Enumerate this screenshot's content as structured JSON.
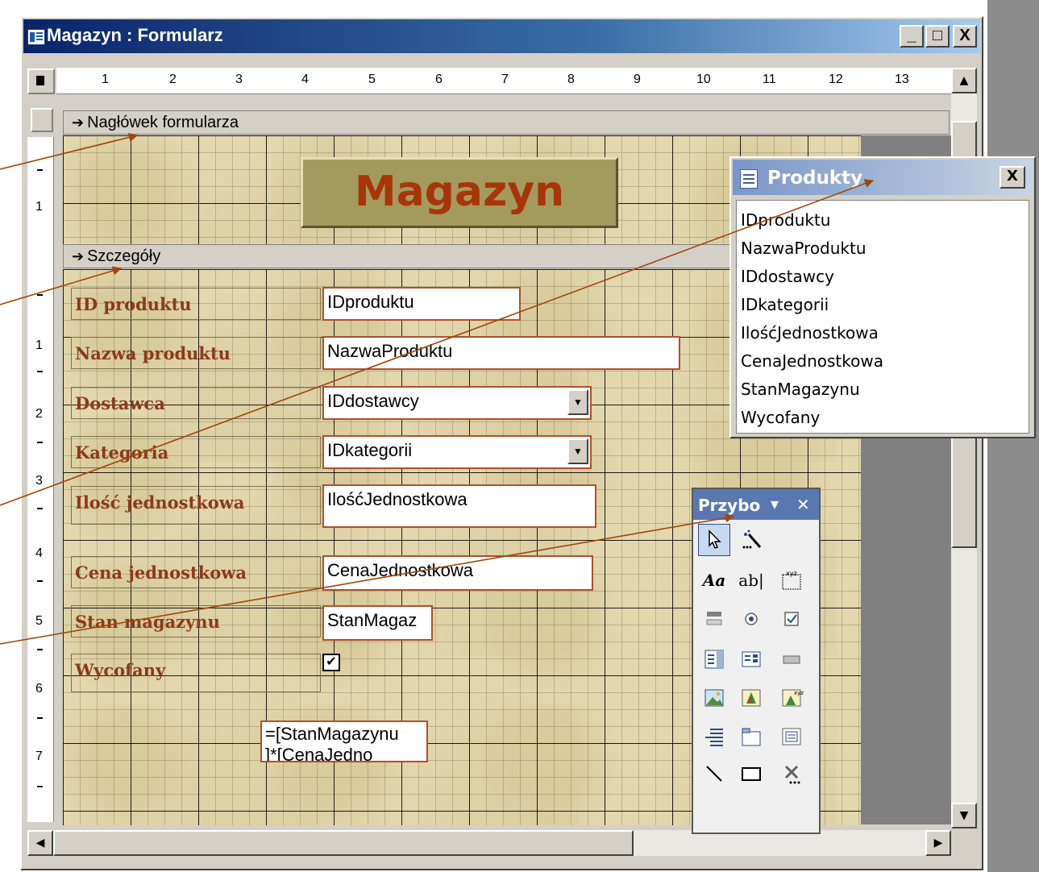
{
  "window": {
    "title": "Magazyn : Formularz",
    "minimize": "_",
    "maximize": "□",
    "close": "X"
  },
  "ruler": {
    "horizontal": [
      "1",
      "2",
      "3",
      "4",
      "5",
      "6",
      "7",
      "8",
      "9",
      "10",
      "11",
      "12",
      "13"
    ],
    "vertical": [
      "1",
      "1",
      "2",
      "3",
      "4",
      "5",
      "6",
      "7"
    ]
  },
  "sections": {
    "header": "Nagłówek formularza",
    "detail": "Szczegóły"
  },
  "form_title": "Magazyn",
  "labels": [
    {
      "text": "ID produktu"
    },
    {
      "text": "Nazwa produktu"
    },
    {
      "text": "Dostawca"
    },
    {
      "text": "Kategoria"
    },
    {
      "text": "Ilość jednostkowa"
    },
    {
      "text": "Cena jednostkowa"
    },
    {
      "text": "Stan magazynu"
    },
    {
      "text": "Wycofany"
    }
  ],
  "fields": {
    "id": "IDproduktu",
    "name": "NazwaProduktu",
    "supplier": "IDdostawcy",
    "category": "IDkategorii",
    "unit_qty": "IlośćJednostkowa",
    "unit_price": "CenaJednostkowa",
    "stock": "StanMagaz",
    "calc_line1": "=[StanMagazynu",
    "calc_line2": "]*[CenaJedno"
  },
  "checkbox": {
    "checked": true,
    "glyph": "✔"
  },
  "field_list": {
    "title": "Produkty",
    "close": "X",
    "items": [
      "IDproduktu",
      "NazwaProduktu",
      "IDdostawcy",
      "IDkategorii",
      "IlośćJednostkowa",
      "CenaJednostkowa",
      "StanMagazynu",
      "Wycofany"
    ]
  },
  "toolbox": {
    "title": "Przybo",
    "menu_glyph": "▾",
    "close_glyph": "✕",
    "label_tool": "Aa",
    "textbox_tool": "ab|",
    "tools": [
      "select-pointer",
      "control-wizards",
      "label",
      "text-box",
      "option-group",
      "toggle-button",
      "option-button",
      "check-box",
      "combo-box",
      "list-box",
      "command-button",
      "image",
      "unbound-object-frame",
      "bound-object-frame",
      "page-break",
      "tab-control",
      "subform",
      "line",
      "rectangle",
      "more-controls"
    ]
  }
}
